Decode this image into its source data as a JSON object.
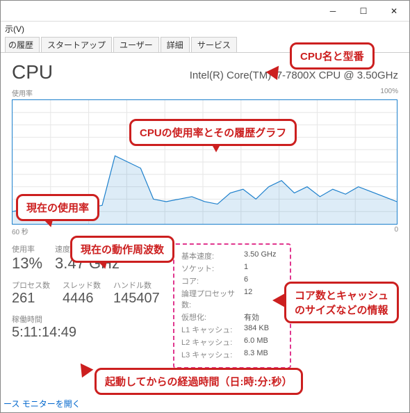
{
  "window": {
    "menu_view": "示(V)"
  },
  "tabs": {
    "history": "の履歴",
    "startup": "スタートアップ",
    "users": "ユーザー",
    "details": "詳細",
    "services": "サービス"
  },
  "header": {
    "title": "CPU",
    "cpu_name": "Intel(R) Core(TM) i7-7800X CPU @ 3.50GHz"
  },
  "graph": {
    "top_left": "使用率",
    "top_right": "100%",
    "bottom_left": "60 秒",
    "bottom_right": "0"
  },
  "stats": {
    "utilization_label": "使用率",
    "utilization_value": "13%",
    "speed_label": "速度",
    "speed_value": "3.47 GHz",
    "processes_label": "プロセス数",
    "processes_value": "261",
    "threads_label": "スレッド数",
    "threads_value": "4446",
    "handles_label": "ハンドル数",
    "handles_value": "145407",
    "uptime_label": "稼働時間",
    "uptime_value": "5:11:14:49"
  },
  "details": {
    "base_speed_k": "基本速度:",
    "base_speed_v": "3.50 GHz",
    "sockets_k": "ソケット:",
    "sockets_v": "1",
    "cores_k": "コア:",
    "cores_v": "6",
    "logical_k": "論理プロセッサ数:",
    "logical_v": "12",
    "virt_k": "仮想化:",
    "virt_v": "有効",
    "l1_k": "L1 キャッシュ:",
    "l1_v": "384 KB",
    "l2_k": "L2 キャッシュ:",
    "l2_v": "6.0 MB",
    "l3_k": "L3 キャッシュ:",
    "l3_v": "8.3 MB"
  },
  "footer": {
    "link": "ース モニターを開く"
  },
  "callouts": {
    "name_model": "CPU名と型番",
    "usage_graph": "CPUの使用率とその履歴グラフ",
    "current_usage": "現在の使用率",
    "current_speed": "現在の動作周波数",
    "cores_cache": "コア数とキャッシュ\nのサイズなどの情報",
    "uptime": "起動してからの経過時間（日:時:分:秒）"
  },
  "chart_data": {
    "type": "line",
    "title": "CPU 使用率",
    "xlabel": "秒",
    "ylabel": "%",
    "xlim": [
      60,
      0
    ],
    "ylim": [
      0,
      100
    ],
    "x": [
      60,
      58,
      56,
      54,
      52,
      50,
      48,
      46,
      44,
      42,
      40,
      38,
      36,
      34,
      32,
      30,
      28,
      26,
      24,
      22,
      20,
      18,
      16,
      14,
      12,
      10,
      8,
      6,
      4,
      2,
      0
    ],
    "values": [
      10,
      12,
      11,
      13,
      12,
      14,
      13,
      15,
      55,
      50,
      45,
      20,
      18,
      20,
      22,
      18,
      16,
      25,
      28,
      20,
      30,
      35,
      25,
      30,
      22,
      28,
      24,
      30,
      26,
      22,
      18
    ]
  }
}
